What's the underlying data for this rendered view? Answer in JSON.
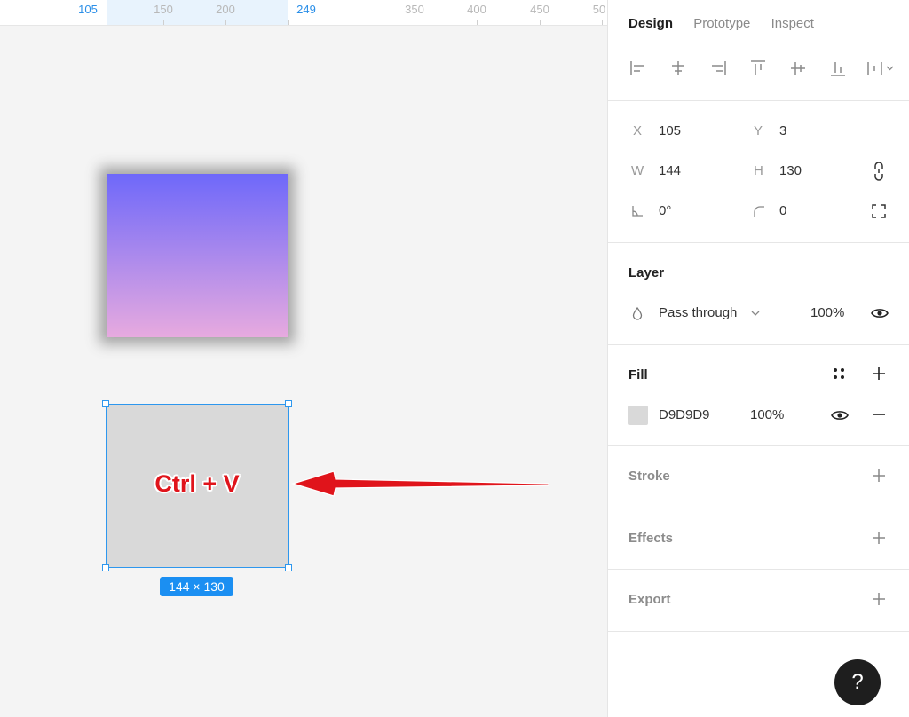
{
  "ruler": {
    "labels": [
      "105",
      "150",
      "200",
      "249",
      "350",
      "400",
      "450",
      "50"
    ]
  },
  "canvas": {
    "annotation": "Ctrl + V",
    "dimensions_badge": "144 × 130",
    "selection_color": "#2d97ee",
    "annotation_color": "#e0141b",
    "gradient_top": "#6e68fa",
    "gradient_bottom": "#e7aadf"
  },
  "tabs": [
    "Design",
    "Prototype",
    "Inspect"
  ],
  "transform": {
    "x_label": "X",
    "x_value": "105",
    "y_label": "Y",
    "y_value": "3",
    "w_label": "W",
    "w_value": "144",
    "h_label": "H",
    "h_value": "130",
    "rotation_value": "0°",
    "radius_value": "0"
  },
  "layer": {
    "title": "Layer",
    "blend_mode": "Pass through",
    "opacity": "100%"
  },
  "fill": {
    "title": "Fill",
    "hex": "D9D9D9",
    "opacity": "100%",
    "swatch_color": "#d9d9d9"
  },
  "stroke": {
    "title": "Stroke"
  },
  "effects": {
    "title": "Effects"
  },
  "export": {
    "title": "Export"
  },
  "help": {
    "label": "?"
  }
}
